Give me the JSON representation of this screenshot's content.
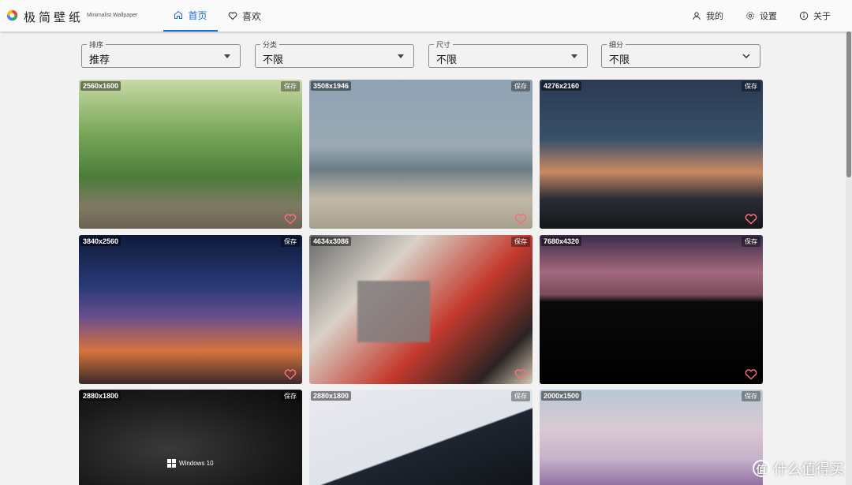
{
  "app": {
    "title": "极简壁纸",
    "subtitle": "Minimalist Wallpaper"
  },
  "nav": {
    "home": "首页",
    "favorites": "喜欢",
    "mine": "我的",
    "settings": "设置",
    "about": "关于"
  },
  "filters": [
    {
      "label": "排序",
      "value": "推荐"
    },
    {
      "label": "分类",
      "value": "不限"
    },
    {
      "label": "尺寸",
      "value": "不限"
    },
    {
      "label": "细分",
      "value": "不限"
    }
  ],
  "wallpapers": [
    {
      "resolution": "2560x1600",
      "save": "保存"
    },
    {
      "resolution": "3508x1946",
      "save": "保存"
    },
    {
      "resolution": "4276x2160",
      "save": "保存"
    },
    {
      "resolution": "3840x2560",
      "save": "保存"
    },
    {
      "resolution": "4634x3086",
      "save": "保存"
    },
    {
      "resolution": "7680x4320",
      "save": "保存"
    },
    {
      "resolution": "2880x1800",
      "save": "保存"
    },
    {
      "resolution": "2880x1800",
      "save": "保存"
    },
    {
      "resolution": "2000x1500",
      "save": "保存"
    }
  ],
  "overlay_text": {
    "windows_logo": "Windows 10",
    "watermark": "什么值得买",
    "watermark_badge": "值"
  },
  "colors": {
    "accent": "#1e6bd6",
    "heart": "#ff6b7a"
  }
}
